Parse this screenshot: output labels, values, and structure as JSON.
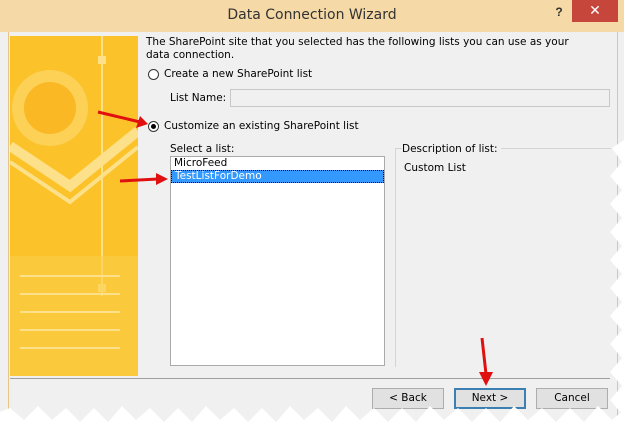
{
  "window": {
    "title": "Data Connection Wizard",
    "help_label": "?",
    "close_label": "✕"
  },
  "intro_text": "The SharePoint site that you selected has the following lists you can use as your data connection.",
  "options": {
    "create_new_label": "Create a new SharePoint list",
    "list_name_label": "List Name:",
    "list_name_value": "",
    "customize_label": "Customize an existing SharePoint list",
    "selected_option": "customize"
  },
  "select_list": {
    "label": "Select a list:",
    "items": [
      "MicroFeed",
      "TestListForDemo"
    ],
    "selected_index": 1
  },
  "description": {
    "label": "Description of list:",
    "value": "Custom List"
  },
  "buttons": {
    "back_label": "< Back",
    "next_label": "Next >",
    "cancel_label": "Cancel"
  },
  "colors": {
    "title_bar": "#f5d9a6",
    "close": "#c7463c",
    "art": "#fbc229",
    "selection": "#3399ff",
    "annotation_arrow": "#e01010"
  }
}
